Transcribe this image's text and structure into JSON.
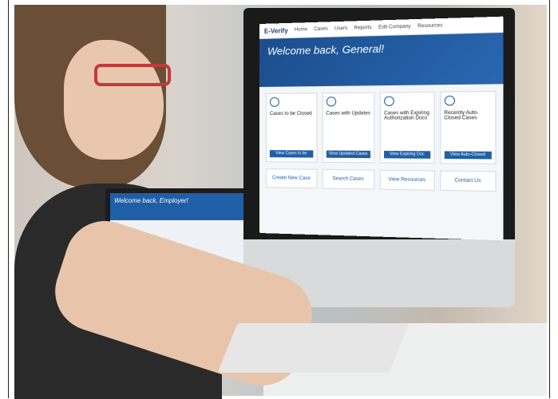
{
  "photo": {
    "description_visible_text": "",
    "monitor": {
      "top_nav": {
        "logo": "E-Verify",
        "items": [
          "Home",
          "Cases",
          "Users",
          "Reports",
          "Edit Company",
          "Resources"
        ]
      },
      "hero_title": "Welcome back, General!",
      "cards": [
        {
          "title": "Cases to be Closed",
          "button": "View Cases to be Closed",
          "icon": "circle-icon"
        },
        {
          "title": "Cases with Updates",
          "button": "View Updated Cases",
          "icon": "bell-icon"
        },
        {
          "title": "Cases with Expiring Authorization Docs",
          "button": "View Expiring Doc Cases",
          "icon": "hourglass-icon"
        },
        {
          "title": "Recently Auto-Closed Cases",
          "button": "View Auto-Closed Cases",
          "icon": "refresh-icon"
        }
      ],
      "links": [
        "Create New Case",
        "Search Cases",
        "View Resources",
        "Contact Us"
      ]
    },
    "laptop": {
      "hero_title": "Welcome back, Employer!"
    }
  }
}
